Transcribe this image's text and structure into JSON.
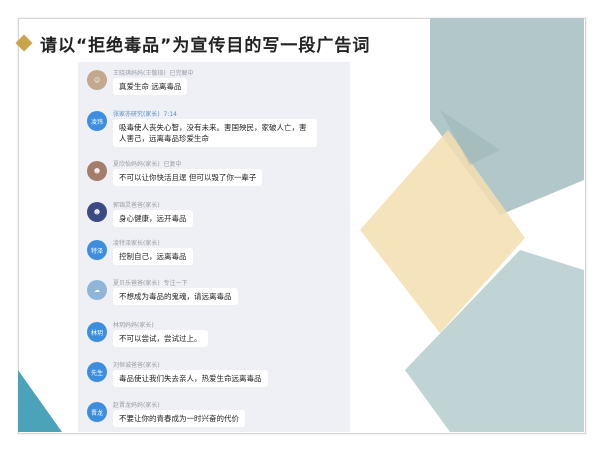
{
  "title": "请以“拒绝毒品”为宣传目的写一段广告词",
  "colors": {
    "teal": "#a9c3c6",
    "cream": "#f3deb0",
    "grey_blue": "#b9c6cc",
    "accent_teal": "#4aa3b8",
    "title_diamond": "#c9a44a"
  },
  "messages": [
    {
      "name": "王晓琪妈妈(王敬琦)",
      "tag": "已完解中",
      "text": "真爱生命 远离毒品",
      "avatar": {
        "label": "",
        "icon": "child-photo-icon",
        "color": "#c2a88f"
      }
    },
    {
      "name": "张家亦研究(家长)",
      "tag": "7:14",
      "text": "吸毒使人丧失心智，没有未来。害国殃民，家破人亡，害人害己，远离毒品珍爱生命",
      "avatar": {
        "label": "凌玮",
        "icon": "",
        "color": "#3e8edf"
      }
    },
    {
      "name": "夏欣怡妈妈(家长)",
      "tag": "已复中",
      "text": "不可以让你快活且逞 但可以毁了你一辈子",
      "avatar": {
        "label": "",
        "icon": "child-photo-icon",
        "color": "#a57d6b"
      }
    },
    {
      "name": "郭锦灵爸爸(家长)",
      "tag": "",
      "text": "身心健康，远开毒品",
      "avatar": {
        "label": "",
        "icon": "child-photo-icon",
        "color": "#3b4a82"
      }
    },
    {
      "name": "凌特泽家长(家长)",
      "tag": "",
      "text": "控制自己，远离毒品",
      "avatar": {
        "label": "特泽",
        "icon": "",
        "color": "#3e8edf"
      }
    },
    {
      "name": "夏贝乐爸爸(家长)",
      "tag": "专注一下",
      "text": "不想成为毒品的鬼魂，请远离毒品",
      "avatar": {
        "label": "",
        "icon": "child-photo-icon",
        "color": "#8fb6d6"
      }
    },
    {
      "name": "林玥妈妈(家长)",
      "tag": "",
      "text": "不可以尝试，尝试过上。",
      "avatar": {
        "label": "林玥",
        "icon": "",
        "color": "#3e8edf"
      }
    },
    {
      "name": "刘恒诚爸爸(家长)",
      "tag": "",
      "text": "毒品使让我们失去亲人，热爱生命远离毒品",
      "avatar": {
        "label": "先生",
        "icon": "",
        "color": "#3e8edf"
      }
    },
    {
      "name": "赵晋龙妈妈(家长)",
      "tag": "",
      "text": "不要让你的青春成为一时兴奋的代价",
      "avatar": {
        "label": "晋龙",
        "icon": "",
        "color": "#3e8edf"
      }
    }
  ]
}
